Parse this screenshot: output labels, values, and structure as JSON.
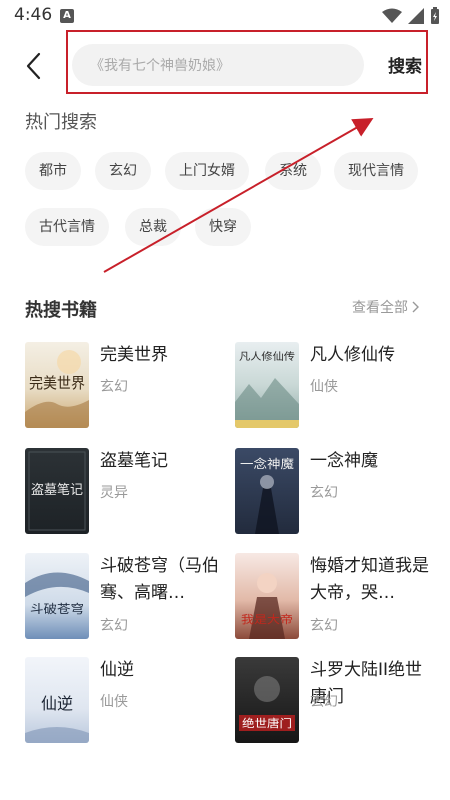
{
  "status_bar": {
    "time": "4:46",
    "notification_badge": "A"
  },
  "search": {
    "placeholder": "《我有七个神兽奶娘》",
    "button_label": "搜索"
  },
  "hot_search": {
    "title": "热门搜索",
    "tags": [
      "都市",
      "玄幻",
      "上门女婿",
      "系统",
      "现代言情",
      "古代言情",
      "总裁",
      "快穿"
    ]
  },
  "hot_books": {
    "title": "热搜书籍",
    "see_all": "查看全部",
    "books": [
      {
        "title": "完美世界",
        "genre": "玄幻",
        "cover_text": "完美世界"
      },
      {
        "title": "凡人修仙传",
        "genre": "仙侠",
        "cover_text": "凡人修仙传"
      },
      {
        "title": "盗墓笔记",
        "genre": "灵异",
        "cover_text": "盗墓笔记"
      },
      {
        "title": "一念神魔",
        "genre": "玄幻",
        "cover_text": "一念神魔"
      },
      {
        "title": "斗破苍穹（马伯骞、高曙…",
        "genre": "玄幻",
        "cover_text": "斗破苍穹"
      },
      {
        "title": "悔婚才知道我是大帝，哭…",
        "genre": "玄幻",
        "cover_text": "我是大帝"
      },
      {
        "title": "仙逆",
        "genre": "仙侠",
        "cover_text": "仙逆"
      },
      {
        "title": "斗罗大陆II绝世唐门",
        "genre": "玄幻",
        "cover_text": "绝世唐门"
      }
    ]
  },
  "colors": {
    "accent_annotation": "#c8202a",
    "tag_bg": "#f4f4f4",
    "search_bg": "#f2f2f2"
  }
}
